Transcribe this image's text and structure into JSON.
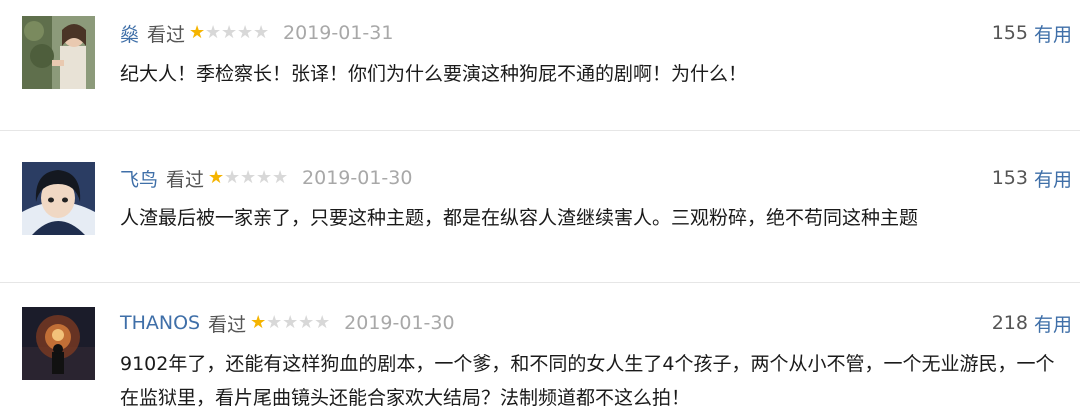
{
  "reviews": [
    {
      "username": "燊",
      "watched": "看过",
      "rating": 1,
      "rating_max": 5,
      "date": "2019-01-31",
      "votes": "155",
      "helpful": "有用",
      "comment": "纪大人！季检察长！张译！你们为什么要演这种狗屁不通的剧啊！为什么！",
      "avatar": "avatar-photo-woman"
    },
    {
      "username": "飞鸟",
      "watched": "看过",
      "rating": 1,
      "rating_max": 5,
      "date": "2019-01-30",
      "votes": "153",
      "helpful": "有用",
      "comment": "人渣最后被一家亲了，只要这种主题，都是在纵容人渣继续害人。三观粉碎，绝不苟同这种主题",
      "avatar": "avatar-photo-anime"
    },
    {
      "username": "THANOS",
      "watched": "看过",
      "rating": 1,
      "rating_max": 5,
      "date": "2019-01-30",
      "votes": "218",
      "helpful": "有用",
      "comment": "9102年了，还能有这样狗血的剧本，一个爹，和不同的女人生了4个孩子，两个从小不管，一个无业游民，一个在监狱里，看片尾曲镜头还能合家欢大结局？法制频道都不这么拍！",
      "avatar": "avatar-photo-fire"
    }
  ],
  "colors": {
    "username": "#3f6fa8",
    "star_on": "#f5b400",
    "star_off": "#d8d8d8",
    "date": "#a8a8a8"
  }
}
